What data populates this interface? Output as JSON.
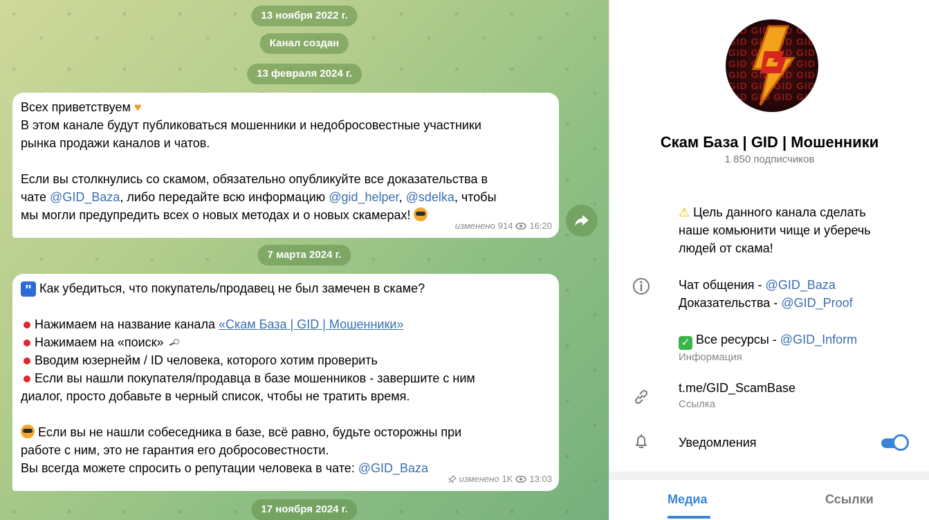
{
  "chat": {
    "dates": [
      "13 ноября 2022 г.",
      "13 февраля 2024 г.",
      "7 марта 2024 г.",
      "17 ноября 2024 г."
    ],
    "service_message": "Канал создан",
    "message1": {
      "greeting": "Всех приветствуем",
      "l2": "В этом канале будут публиковаться мошенники и недобросовестные участники",
      "l3": "рынка продажи каналов и чатов.",
      "l5a": "Если вы столкнулись со скамом, обязательно опубликуйте все доказательства в",
      "l6_pre": "чате ",
      "l6_link1": "@GID_Baza",
      "l6_mid": ", либо передайте всю информацию ",
      "l6_link2": "@gid_helper",
      "l6_sep": ", ",
      "l6_link3": "@sdelka",
      "l6_post": ", чтобы",
      "l7": "мы могли предупредить всех о новых методах и о новых скамерах!",
      "edited": "изменено",
      "views": "914",
      "time": "16:20"
    },
    "message2": {
      "l1": "Как убедиться, что покупатель/продавец не был замечен в скаме?",
      "b1_pre": "Нажимаем на название канала ",
      "b1_link": "«Скам База | GID | Мошенники»",
      "b2": "Нажимаем на «поиск»",
      "b3": "Вводим юзернейм / ID человека, которого хотим проверить",
      "b4": "Если вы нашли покупателя/продавца в базе мошенников - завершите с ним",
      "b4b": "диалог, просто добавьте в черный список, чтобы не тратить время.",
      "p1": "Если вы не нашли собеседника в базе, всё равно, будьте осторожны при",
      "p2": "работе с ним, это не гарантия его добросовестности.",
      "p3_pre": "Вы всегда можете спросить о репутации человека в чате: ",
      "p3_link": "@GID_Baza",
      "edited": "изменено",
      "views": "1K",
      "time": "13:03"
    }
  },
  "panel": {
    "avatar_bg": "GID GID GID GID",
    "title": "Скам База | GID | Мошенники",
    "subscribers": "1 850 подписчиков",
    "description": {
      "l1": "Цель данного канала сделать",
      "l2": "наше комьюнити чище и уберечь",
      "l3": "людей от скама!",
      "chat_pre": "Чат общения - ",
      "chat_link": "@GID_Baza",
      "proof_pre": "Доказательства - ",
      "proof_link": "@GID_Proof",
      "res_pre": "Все ресурсы - ",
      "res_link": "@GID_Inform",
      "info_label": "Информация"
    },
    "link": {
      "value": "t.me/GID_ScamBase",
      "label": "Ссылка"
    },
    "notifications": {
      "label": "Уведомления",
      "enabled": true
    },
    "tabs": [
      "Медиа",
      "Ссылки"
    ]
  },
  "colors": {
    "accent": "#3a84d8",
    "link": "#3a6fb0",
    "chat_bg": "#9ec585"
  },
  "icons": [
    "heart-emoji-icon",
    "sunglasses-face-icon",
    "quote-icon",
    "red-dot-icon",
    "magnifier-icon",
    "warning-icon",
    "check-icon",
    "info-icon",
    "link-icon",
    "bell-icon",
    "eye-icon",
    "pin-icon",
    "forward-icon"
  ]
}
